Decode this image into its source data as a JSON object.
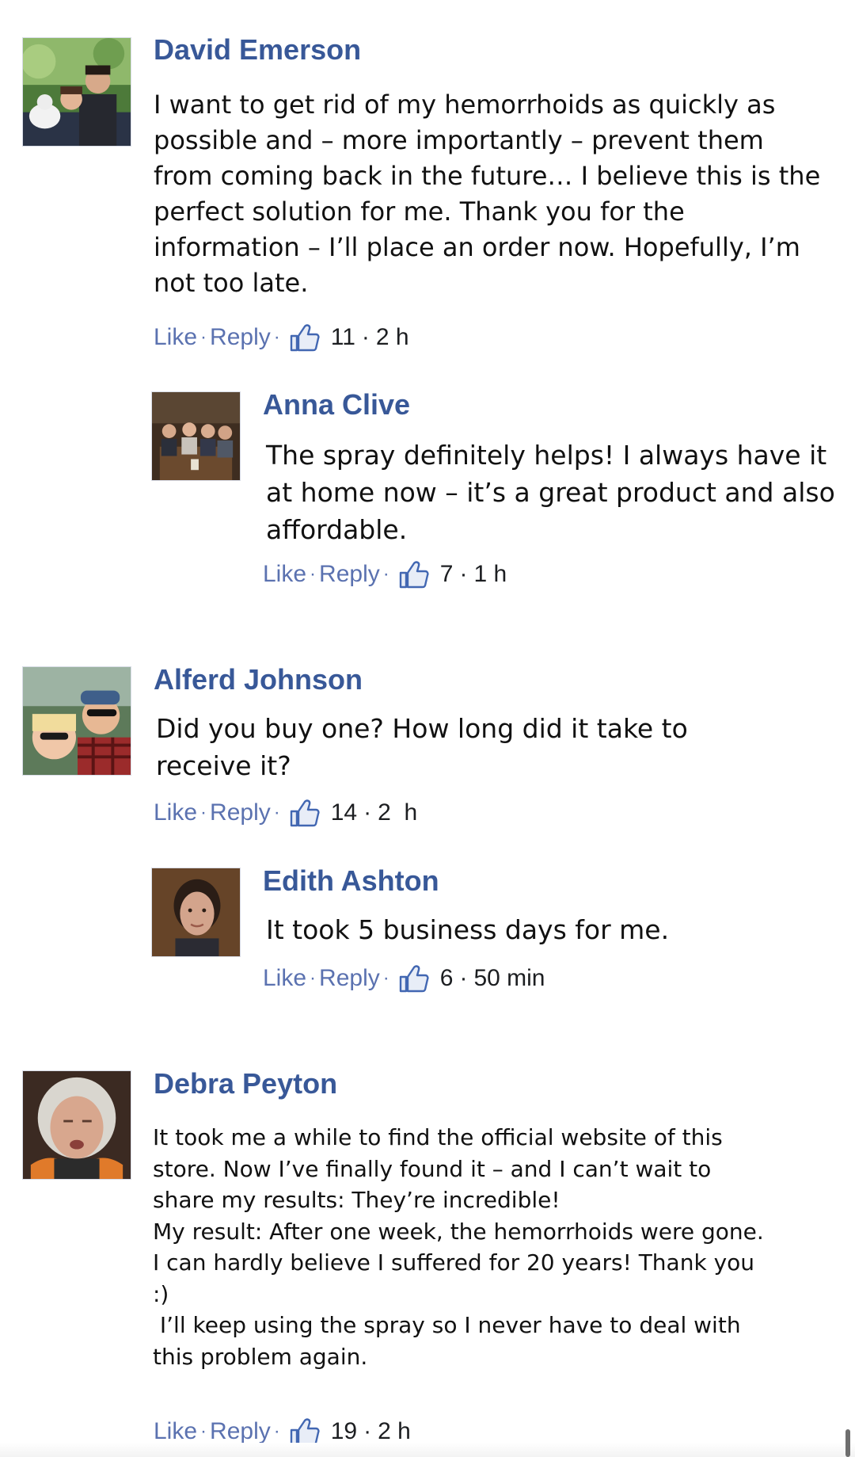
{
  "comments": [
    {
      "author": "David Emerson",
      "text_lines": [
        "I want to get rid of my hemorrhoids as quickly as",
        "possible and – more importantly – prevent them",
        "from coming back in the future… I believe this is the",
        "perfect solution for me. Thank you for the",
        "information – I’ll place an order now. Hopefully, I’m",
        "not too late."
      ],
      "like_label": "Like",
      "reply_label": "Reply",
      "likes": "11",
      "time": "2 h"
    },
    {
      "author": "Anna Clive",
      "text_lines": [
        "The spray definitely helps! I always have it",
        "at home now – it’s a great product and also",
        "affordable."
      ],
      "like_label": "Like",
      "reply_label": "Reply",
      "likes": "7",
      "time": "1 h"
    },
    {
      "author": "Alferd Johnson",
      "text_lines": [
        "Did you buy one? How long did it take to",
        "receive it?"
      ],
      "like_label": "Like",
      "reply_label": "Reply",
      "likes": "14",
      "time": "2  h"
    },
    {
      "author": "Edith Ashton",
      "text_lines": [
        "It took 5 business days for me."
      ],
      "like_label": "Like",
      "reply_label": "Reply",
      "likes": "6",
      "time": "50 min"
    },
    {
      "author": "Debra Peyton",
      "text_lines": [
        "It took me a while to find the official website of this",
        "store. Now I’ve finally found it – and I can’t wait to",
        "share my results: They’re incredible!",
        "My result: After one week, the hemorrhoids were gone.",
        "I can hardly believe I suffered for 20 years! Thank you",
        ":)",
        " I’ll keep using the spray so I never have to deal with",
        "this problem again."
      ],
      "like_label": "Like",
      "reply_label": "Reply",
      "likes": "19",
      "time": "2 h"
    }
  ],
  "meta_separator": "·",
  "icons": {
    "like": "thumbs-up-icon"
  },
  "colors": {
    "author": "#385898",
    "link": "#5b72b0",
    "text": "#111111"
  }
}
